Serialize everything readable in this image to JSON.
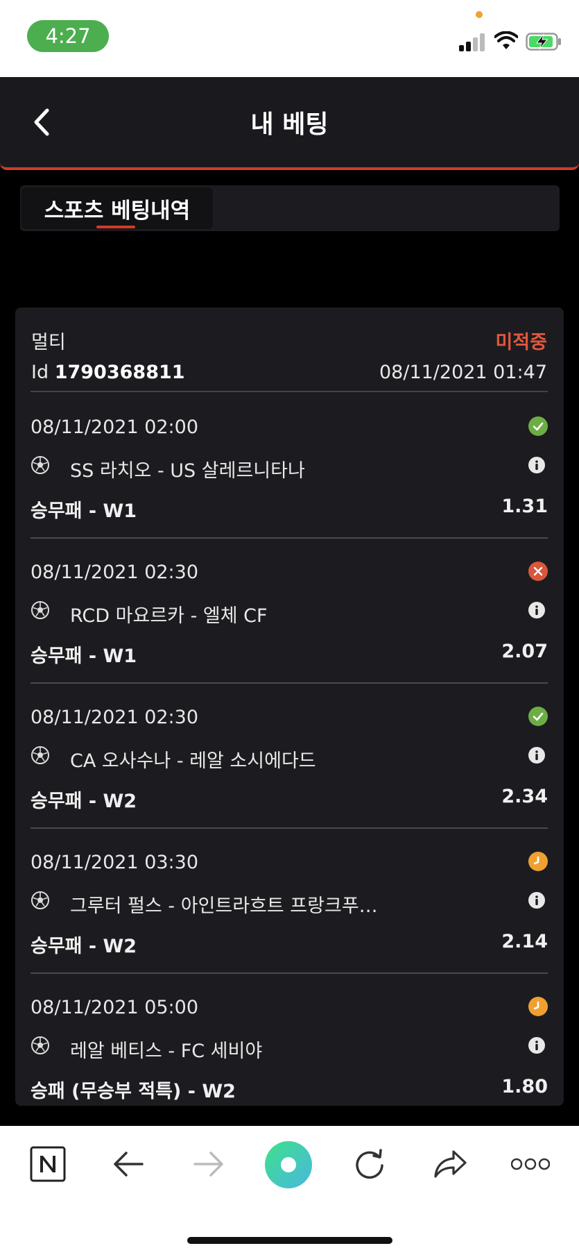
{
  "status_bar": {
    "time": "4:27"
  },
  "header": {
    "title": "내 베팅"
  },
  "tabs": [
    {
      "label": "스포츠 베팅내역"
    }
  ],
  "bet": {
    "type": "멀티",
    "status": "미적중",
    "id_prefix": "Id ",
    "id": "1790368811",
    "date": "08/11/2021 01:47",
    "items": [
      {
        "date": "08/11/2021 02:00",
        "result": "won",
        "match": "SS 라치오 - US 살레르니타나",
        "market": "승무패 - W1",
        "odds": "1.31"
      },
      {
        "date": "08/11/2021 02:30",
        "result": "lost",
        "match": "RCD 마요르카 - 엘체 CF",
        "market": "승무패 - W1",
        "odds": "2.07"
      },
      {
        "date": "08/11/2021 02:30",
        "result": "won",
        "match": "CA 오사수나 - 레알 소시에다드",
        "market": "승무패 - W2",
        "odds": "2.34"
      },
      {
        "date": "08/11/2021 03:30",
        "result": "pending",
        "match": "그루터 펄스 - 아인트라흐트 프랑크푸…",
        "market": "승무패 - W2",
        "odds": "2.14"
      },
      {
        "date": "08/11/2021 05:00",
        "result": "pending",
        "match": "레알 베티스 - FC 세비야",
        "market": "승패 (무승부 적특) - W2",
        "odds": "1.80"
      }
    ]
  },
  "colors": {
    "accent": "#d43a23",
    "won": "#6cae45",
    "lost": "#d9573c",
    "pending": "#f0a030",
    "lost_text": "#e2573c"
  },
  "icons": {
    "back": "chevron-left-icon",
    "won": "check-circle-icon",
    "lost": "x-circle-icon",
    "pending": "clock-icon",
    "sport": "soccer-ball-icon",
    "info": "info-icon"
  }
}
